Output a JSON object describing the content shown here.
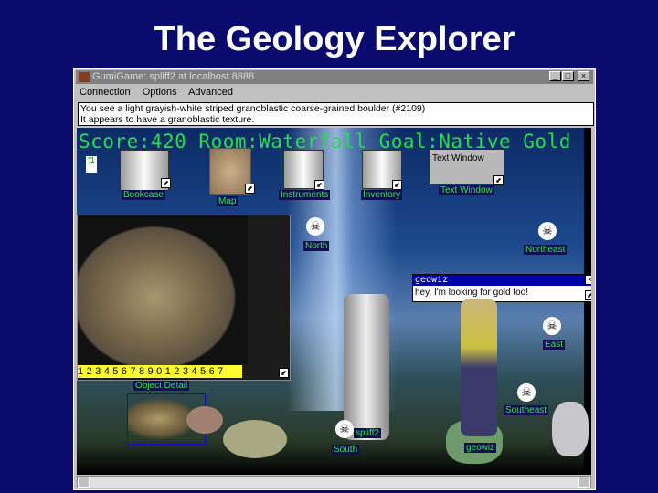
{
  "slide_title": "The Geology Explorer",
  "window": {
    "title": "GumiGame: spliff2 at localhost 8888",
    "minimize": "_",
    "maximize": "□",
    "close": "×"
  },
  "menu": [
    "Connection",
    "Options",
    "Advanced"
  ],
  "message": {
    "line1": "You see a light grayish-white striped granoblastic coarse-grained boulder (#2109)",
    "line2": "It appears to have a granoblastic texture."
  },
  "status": "Score:420 Room:Waterfall Goal:Native Gold",
  "toolbar": [
    {
      "label": "Bookcase"
    },
    {
      "label": "Map"
    },
    {
      "label": "Instruments"
    },
    {
      "label": "Inventory"
    },
    {
      "label": "Text Window",
      "tile_text": "Text Window"
    }
  ],
  "detail": {
    "label": "Object Detail",
    "ruler": "1 2 3 4 5 6 7 8 9 0 1 2 3 4 5 6 7"
  },
  "chat": {
    "title": "geowiz",
    "close": "×",
    "text": "hey, I'm looking for gold too!"
  },
  "exits": [
    "North",
    "Northeast",
    "East",
    "Southeast",
    "South"
  ],
  "players": [
    "spliff2",
    "geowiz"
  ],
  "resize_glyph": "⬋",
  "skull_glyph": "☠"
}
